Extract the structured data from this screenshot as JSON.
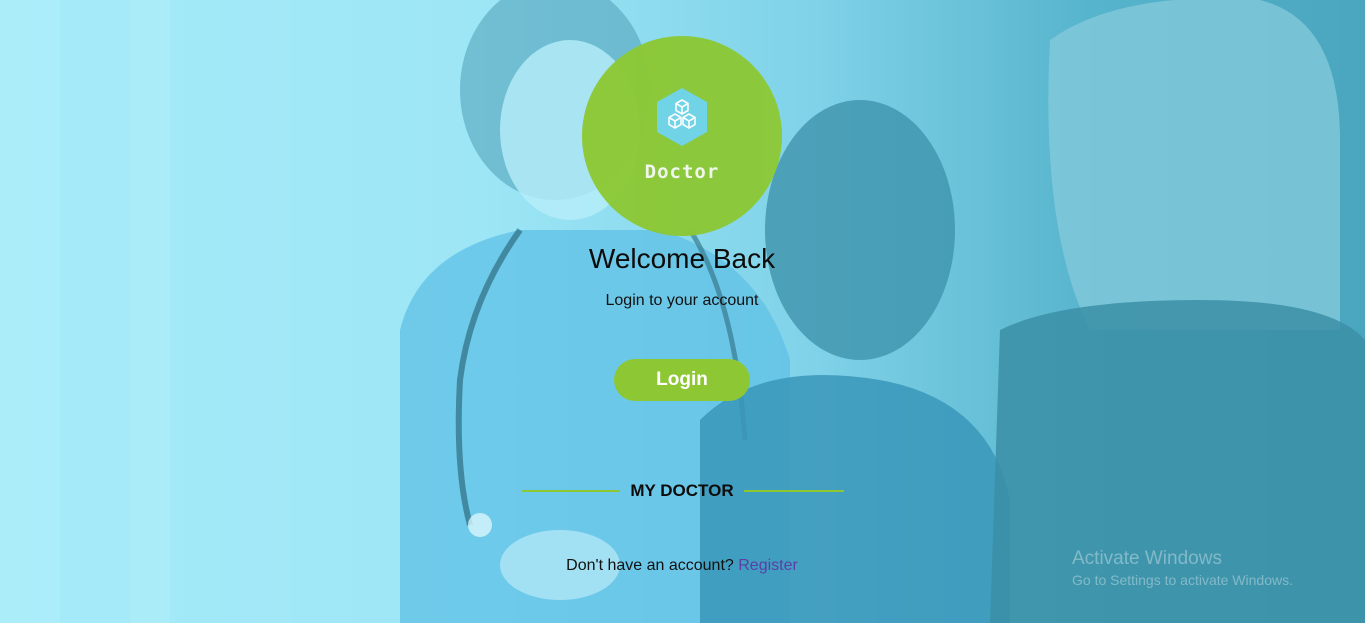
{
  "logo": {
    "text": "Doctor",
    "icon": "cubes-hexagon-icon"
  },
  "welcome": {
    "title": "Welcome Back",
    "subtitle": "Login to your account"
  },
  "login_button": {
    "label": "Login"
  },
  "divider": {
    "label": "MY DOCTOR"
  },
  "footer": {
    "prompt": "Don't have an account?",
    "register_label": "Register"
  },
  "watermark": {
    "title": "Activate Windows",
    "subtitle": "Go to Settings to activate Windows."
  },
  "colors": {
    "accent": "#8dc834",
    "background_tint": "#9de6f6",
    "link": "#5b3ea6",
    "logo_hex": "#6fd3e6"
  }
}
